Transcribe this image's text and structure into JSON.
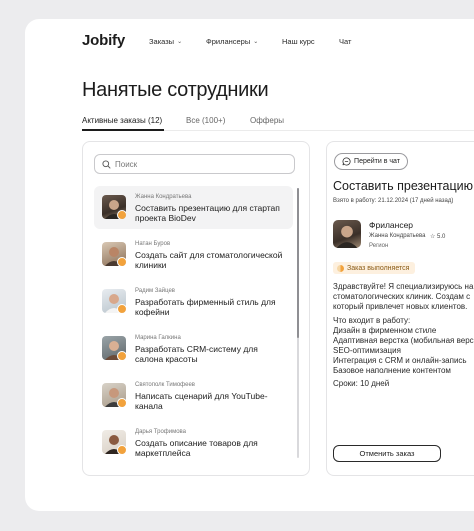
{
  "header": {
    "logo": "Jobify",
    "nav": [
      {
        "label": "Заказы",
        "has_dropdown": true
      },
      {
        "label": "Фрилансеры",
        "has_dropdown": true
      },
      {
        "label": "Наш курс",
        "has_dropdown": false
      },
      {
        "label": "Чат",
        "has_dropdown": false
      }
    ]
  },
  "page": {
    "title": "Нанятые сотрудники",
    "tabs": [
      {
        "label": "Активные заказы",
        "count": "(12)",
        "active": true
      },
      {
        "label": "Все (100+)",
        "active": false
      },
      {
        "label": "Офферы",
        "active": false
      }
    ]
  },
  "list": {
    "search_placeholder": "Поиск",
    "items": [
      {
        "name": "Жанна Кондратьева",
        "task": "Составить презентацию для стартап проекта BioDev",
        "selected": true
      },
      {
        "name": "Натан Буров",
        "task": "Создать сайт для стоматологической клиники",
        "selected": false
      },
      {
        "name": "Радим Зайцев",
        "task": "Разработать фирменный стиль для кофейни",
        "selected": false
      },
      {
        "name": "Марина Галкина",
        "task": "Разработать CRM-систему для салона красоты",
        "selected": false
      },
      {
        "name": "Святополк Тимофеев",
        "task": "Написать сценарий для YouTube-канала",
        "selected": false
      },
      {
        "name": "Дарья Трофимова",
        "task": "Создать описание товаров для маркетплейса",
        "selected": false
      }
    ]
  },
  "detail": {
    "chat_button": "Перейти в чат",
    "title": "Составить презентацию",
    "taken_date": "Взято в работу: 21.12.2024 (17 дней назад)",
    "role": "Фрилансер",
    "name": "Жанна Кондратьева",
    "rating": "☆ 5.0",
    "region": "Регион",
    "status": "Заказ выполняется",
    "description_lines": [
      "Здравствуйте! Я специализируюсь на",
      "стоматологических клиник. Создам с",
      "который привлечет новых клиентов.",
      "",
      "Что входит в работу:",
      "    Дизайн в фирменном стиле",
      "    Адаптивная верстка (мобильная верс",
      "    SEO-оптимизация",
      "    Интеграция с CRM и онлайн-запись",
      "    Базовое наполнение контентом",
      "",
      "Сроки: 10 дней"
    ],
    "cancel_button": "Отменить заказ"
  },
  "colors": {
    "accent": "#f2a23c",
    "status_bg": "#fdf0df",
    "text": "#1c1c1c"
  }
}
